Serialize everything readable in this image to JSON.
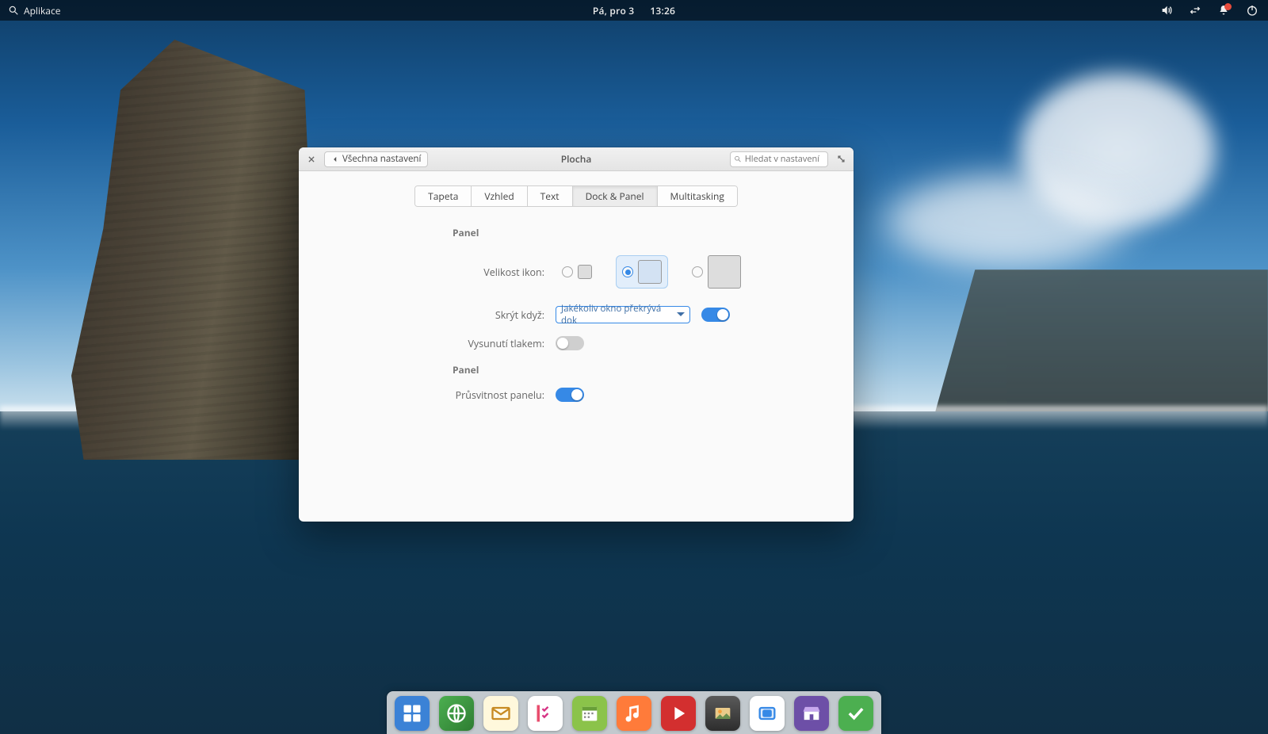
{
  "panel": {
    "apps_label": "Aplikace",
    "date": "Pá, pro 3",
    "time": "13:26"
  },
  "window": {
    "title": "Plocha",
    "back_label": "Všechna nastavení",
    "search_placeholder": "Hledat v nastavení",
    "tabs": {
      "tapeta": "Tapeta",
      "vzhled": "Vzhled",
      "text": "Text",
      "dock": "Dock & Panel",
      "multitask": "Multitasking"
    },
    "sections": {
      "panel1": "Panel",
      "panel2": "Panel"
    },
    "labels": {
      "icon_size": "Velikost ikon:",
      "hide_when": "Skrýt když:",
      "pressure": "Vysunutí tlakem:",
      "translucency": "Průsvitnost panelu:"
    },
    "hide_when_value": "Jakékoliv okno překrývá dok",
    "toggles": {
      "hide_enabled": true,
      "pressure": false,
      "translucency": true
    },
    "icon_size_selected": "medium"
  },
  "notification_color": "#e74c3c"
}
